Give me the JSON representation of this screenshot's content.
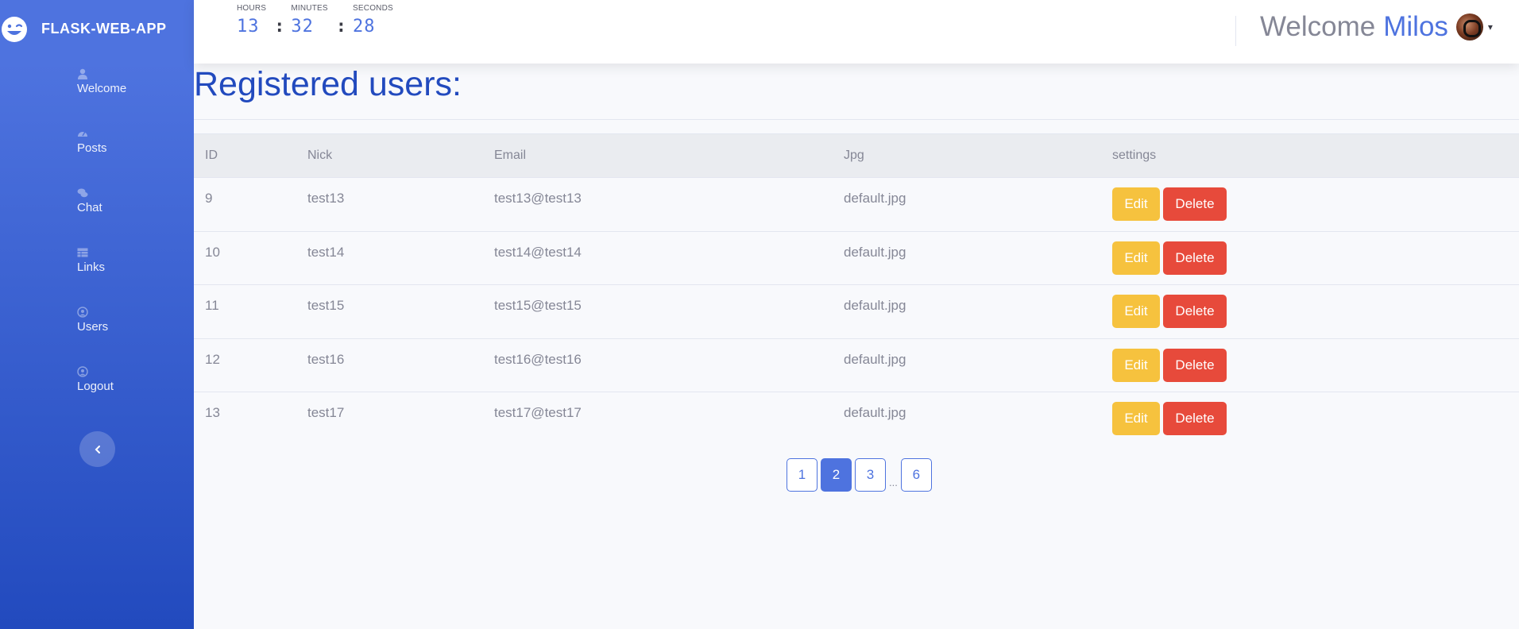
{
  "brand": {
    "name": "FLASK-WEB-APP",
    "icon": "laugh-wink-icon"
  },
  "sidebar": {
    "items": [
      {
        "label": "Welcome",
        "icon": "user-icon"
      },
      {
        "label": "Posts",
        "icon": "tachometer-icon"
      },
      {
        "label": "Chat",
        "icon": "comments-icon"
      },
      {
        "label": "Links",
        "icon": "table-icon"
      },
      {
        "label": "Users",
        "icon": "user-circle-icon"
      },
      {
        "label": "Logout",
        "icon": "user-circle-icon"
      }
    ],
    "toggle_icon": "chevron-left-icon"
  },
  "clock": {
    "hours_label": "HOURS",
    "minutes_label": "MINUTES",
    "seconds_label": "SECONDS",
    "hours": "13",
    "minutes": "32",
    "seconds": "28",
    "separator": ":"
  },
  "topbar": {
    "welcome": "Welcome",
    "user": "Milos",
    "caret": "▾"
  },
  "main": {
    "title": "Registered users:",
    "columns": [
      "ID",
      "Nick",
      "Email",
      "Jpg",
      "settings"
    ],
    "rows": [
      {
        "id": "9",
        "nick": "test13",
        "email": "test13@test13",
        "jpg": "default.jpg"
      },
      {
        "id": "10",
        "nick": "test14",
        "email": "test14@test14",
        "jpg": "default.jpg"
      },
      {
        "id": "11",
        "nick": "test15",
        "email": "test15@test15",
        "jpg": "default.jpg"
      },
      {
        "id": "12",
        "nick": "test16",
        "email": "test16@test16",
        "jpg": "default.jpg"
      },
      {
        "id": "13",
        "nick": "test17",
        "email": "test17@test17",
        "jpg": "default.jpg"
      }
    ],
    "edit_label": "Edit",
    "delete_label": "Delete"
  },
  "pagination": {
    "pages": [
      "1",
      "2",
      "3"
    ],
    "ellipsis": "...",
    "last": "6",
    "active": "2"
  },
  "colors": {
    "primary": "#4e73df",
    "warning": "#f6c23e",
    "danger": "#e74a3b"
  }
}
